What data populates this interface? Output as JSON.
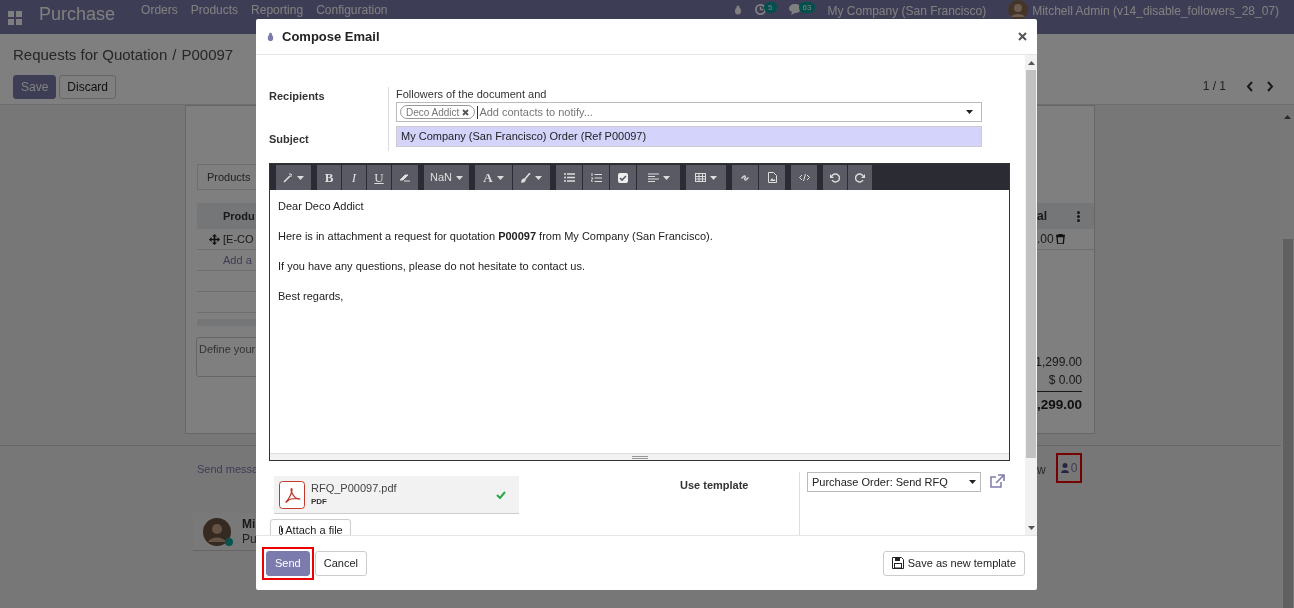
{
  "navbar": {
    "app_title": "Purchase",
    "menu": [
      "Orders",
      "Products",
      "Reporting",
      "Configuration"
    ],
    "activity_count": "5",
    "message_count": "63",
    "company": "My Company (San Francisco)",
    "user": "Mitchell Admin (v14_disable_followers_28_07)"
  },
  "breadcrumb": {
    "parent": "Requests for Quotation",
    "separator": "/",
    "current": "P00097"
  },
  "form_buttons": [
    {
      "label": "Save",
      "kind": "primary"
    },
    {
      "label": "Discard",
      "kind": "secondary"
    }
  ],
  "pager": "1 / 1",
  "sheet": {
    "tab": "Products",
    "column_1": "Produ",
    "column_2": "al",
    "row_cell_1": "[E-CO",
    "row_cell_2": ".00",
    "add_line": "Add a",
    "notes_placeholder": "Define your",
    "totals": [
      "1,299.00",
      "$ 0.00",
      ",299.00"
    ]
  },
  "chatter": {
    "send_message": "Send messa",
    "column_3": "w",
    "follower_count": "0",
    "follower_highlighted": true,
    "message": {
      "author": "Mi",
      "body": "Pu"
    }
  },
  "dialog": {
    "title": "Compose Email",
    "recipients_label": "Recipients",
    "followers_note": "Followers of the document and",
    "tags": [
      {
        "label": "Deco Addict"
      }
    ],
    "contacts_placeholder": "Add contacts to notify...",
    "subject_label": "Subject",
    "subject": "My Company (San Francisco) Order (Ref P00097)",
    "toolbar_labels": {
      "font_size": "NaN",
      "bold": "B",
      "italic": "I",
      "underline": "U",
      "font_color": "A"
    },
    "body": [
      "Dear Deco Addict",
      "Here is in attachment a request for quotation **P00097** from My Company (San Francisco).",
      "If you have any questions, please do not hesitate to contact us.",
      "Best regards,"
    ],
    "attachment": {
      "name": "RFQ_P00097.pdf",
      "type": "PDF",
      "uploaded": true
    },
    "attach_button": "Attach a file",
    "template_label": "Use template",
    "template": "Purchase Order: Send RFQ",
    "buttons": [
      {
        "label": "Send",
        "kind": "primary",
        "highlighted": true
      },
      {
        "label": "Cancel",
        "kind": "secondary",
        "highlighted": false
      },
      {
        "label": "Save as new template",
        "kind": "save",
        "highlighted": false
      }
    ]
  }
}
